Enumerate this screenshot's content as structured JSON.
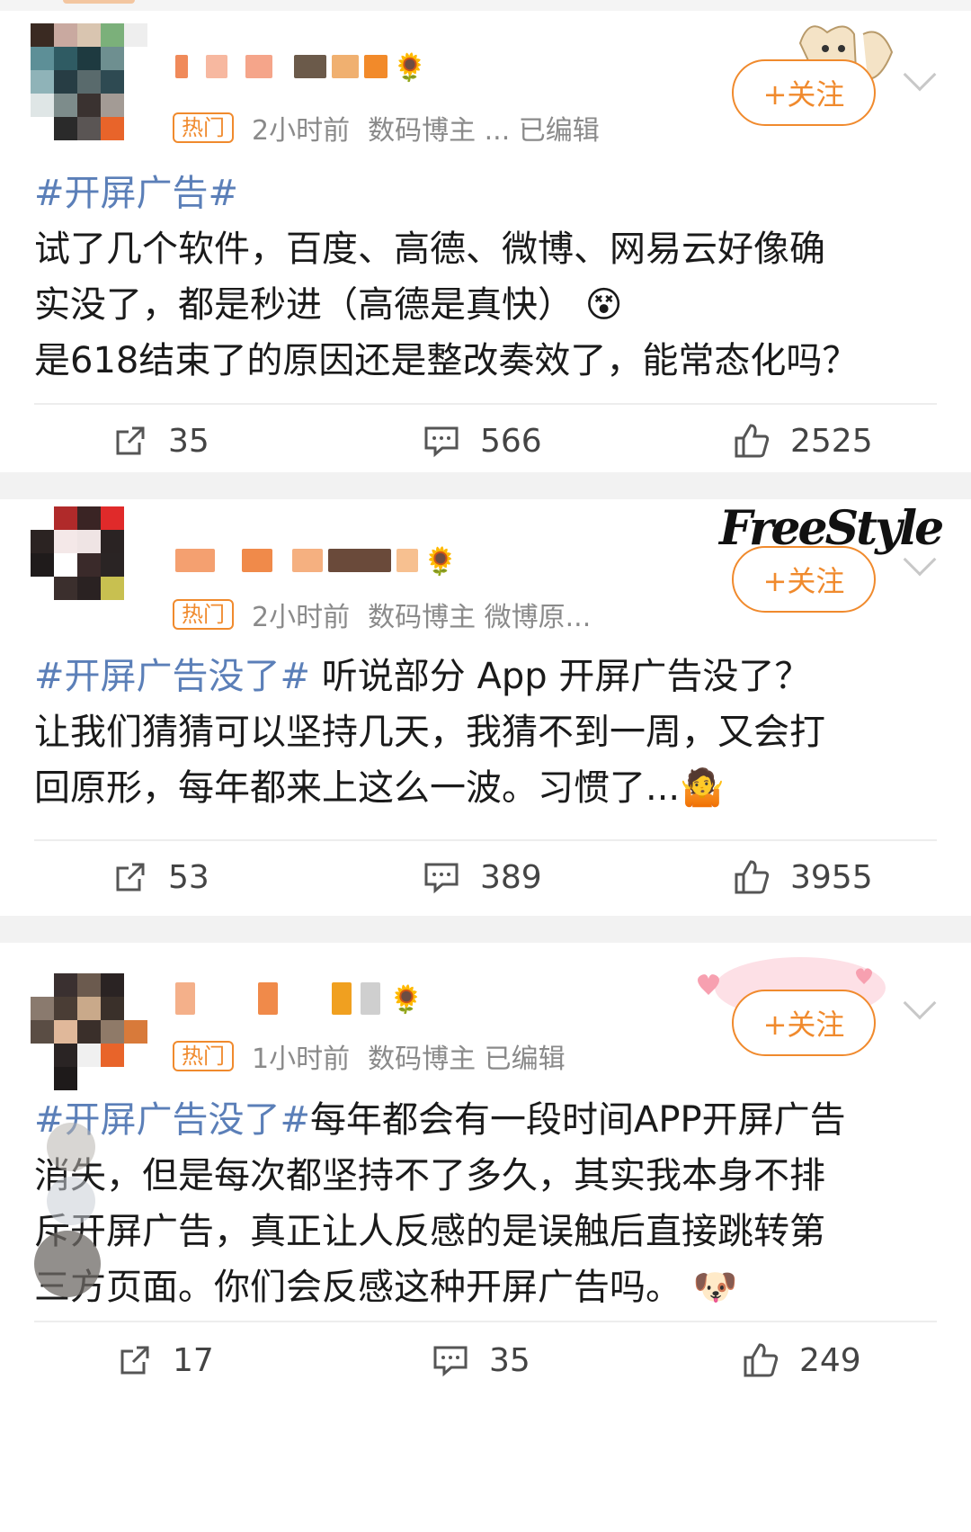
{
  "follow_label": "+关注",
  "hot_badge": "热门",
  "posts": [
    {
      "time": "2小时前",
      "source": "数码博主 ... 已编辑",
      "body_tag": "#开屏广告#",
      "body_lines": [
        "试了几个软件，百度、高德、微博、网易云好像确",
        "实没了，都是秒进（高德是真快）",
        "是618结束了的原因还是整改奏效了，能常态化吗？"
      ],
      "emoji": "😵",
      "reposts": "35",
      "comments": "566",
      "likes": "2525"
    },
    {
      "time": "2小时前",
      "source": "数码博主 微博原...",
      "body_tag": "#开屏广告没了#",
      "body_first_rest": " 听说部分 App 开屏广告没了？",
      "body_lines": [
        "让我们猜猜可以坚持几天，我猜不到一周，又会打",
        "回原形，每年都来上这么一波。习惯了..."
      ],
      "emoji": "🤷",
      "deco_text": "FreeStyle",
      "reposts": "53",
      "comments": "389",
      "likes": "3955"
    },
    {
      "time": "1小时前",
      "source": "数码博主 已编辑",
      "body_tag": "#开屏广告没了#",
      "body_first_rest": "每年都会有一段时间APP开屏广告",
      "body_lines": [
        "消失，但是每次都坚持不了多久，其实我本身不排",
        "斥开屏广告，真正让人反感的是误触后直接跳转第",
        "三方页面。你们会反感这种开屏广告吗。"
      ],
      "emoji": "🐶",
      "reposts": "17",
      "comments": "35",
      "likes": "249"
    }
  ]
}
